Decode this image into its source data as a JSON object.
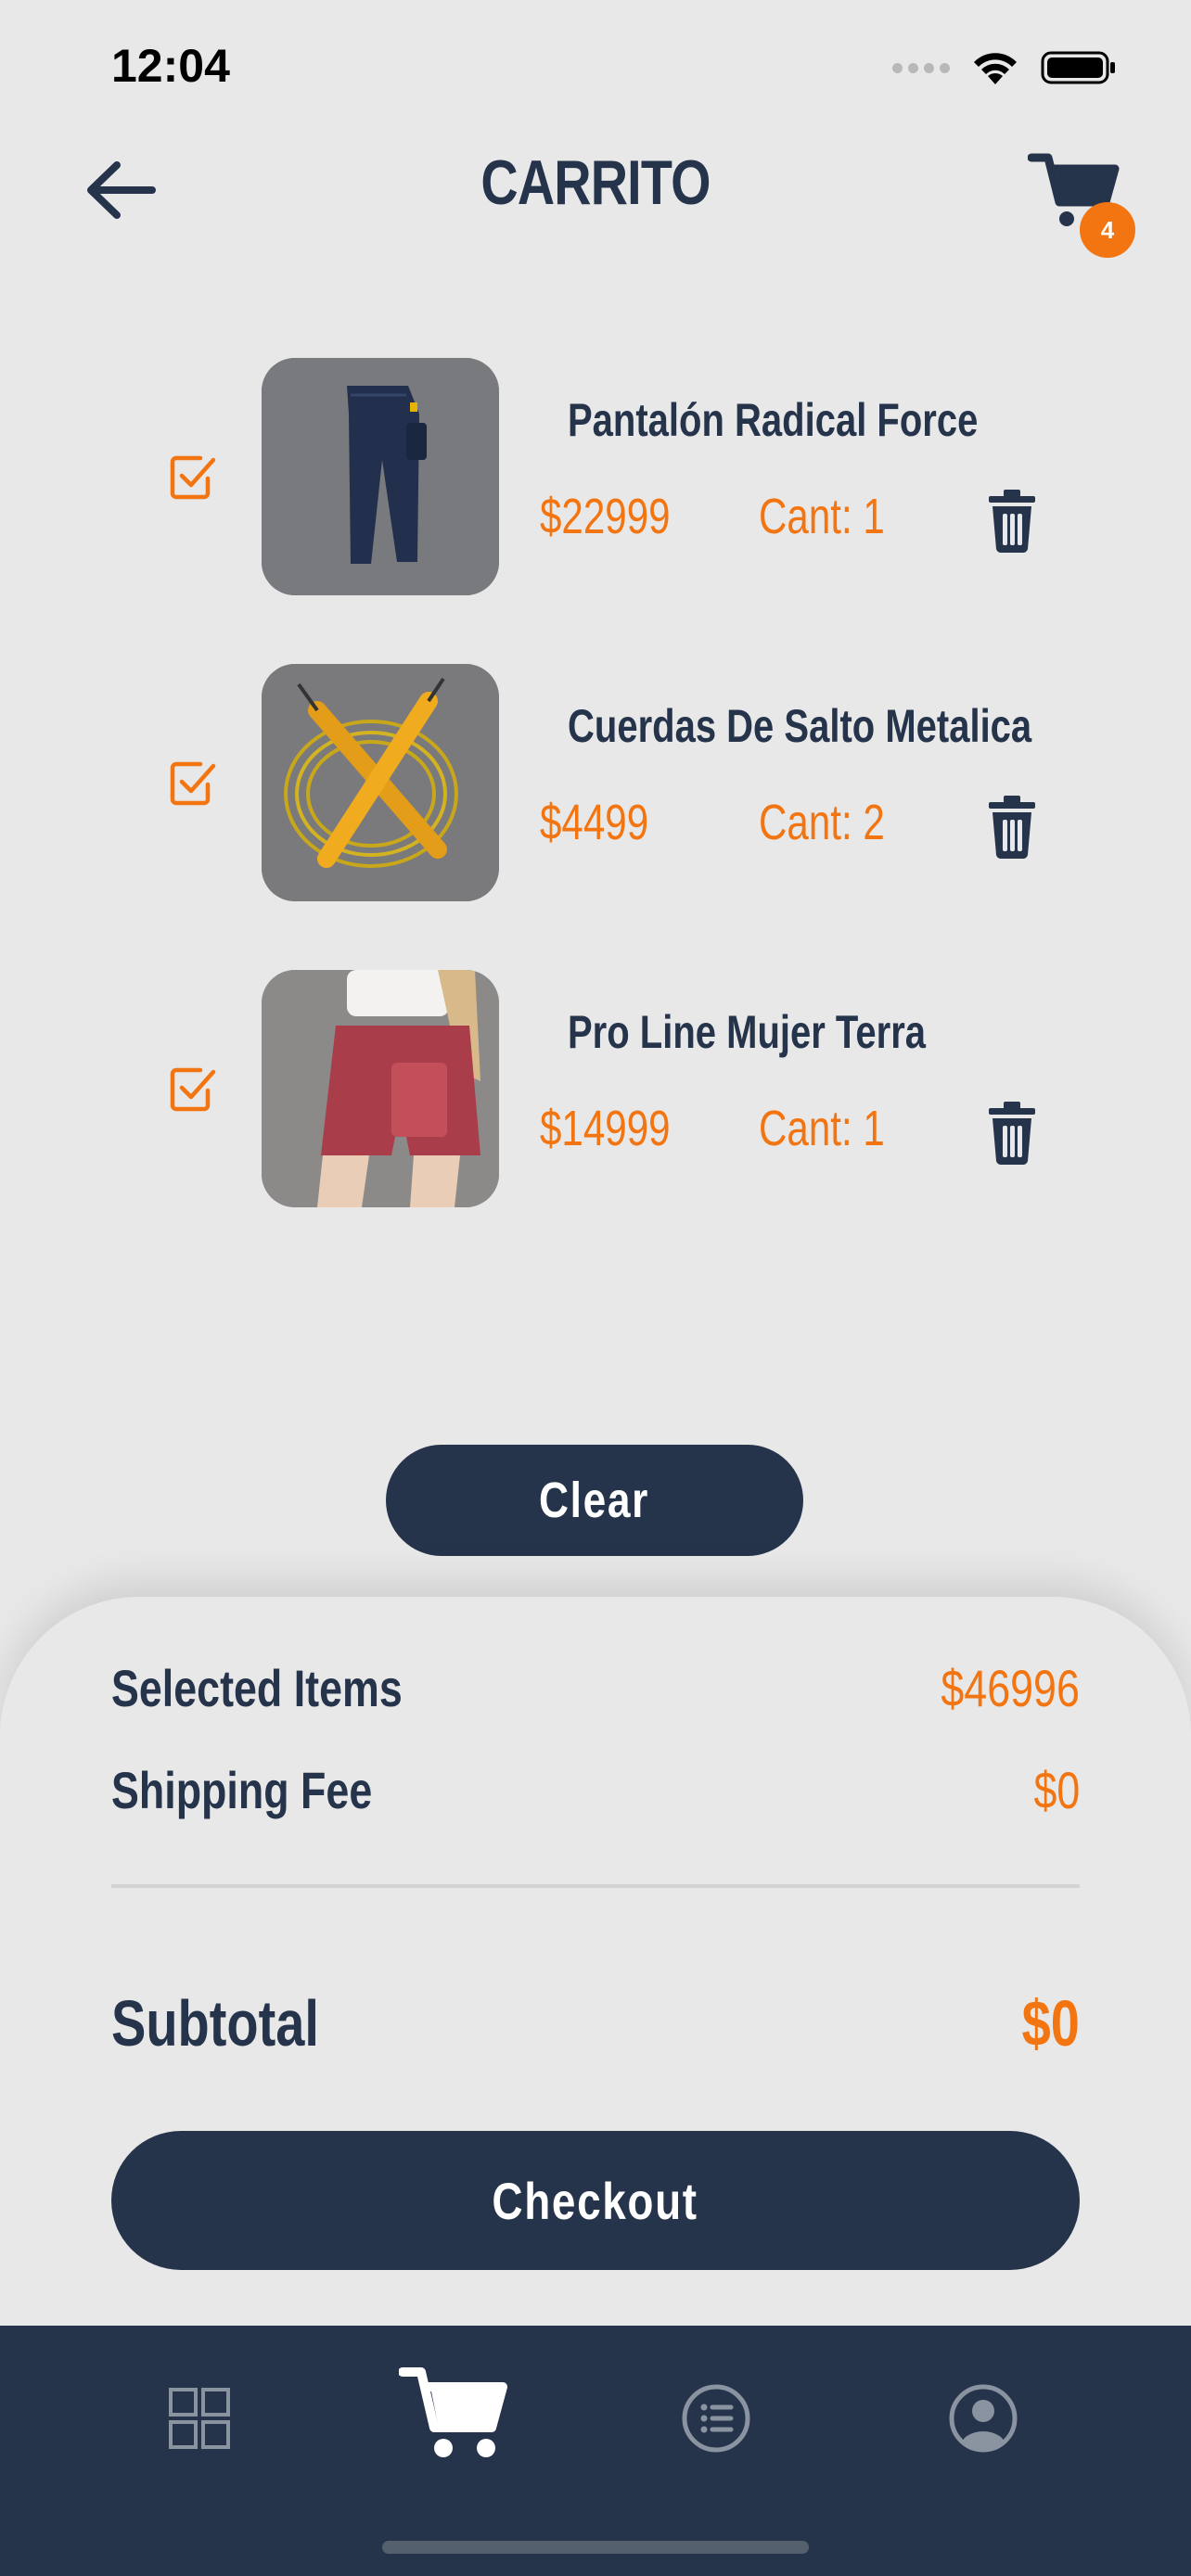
{
  "status_bar": {
    "time": "12:04"
  },
  "header": {
    "title": "CARRITO",
    "cart_badge": "4"
  },
  "items": [
    {
      "name": "Pantalón Radical Force",
      "price": "$22999",
      "quantity": "Cant: 1",
      "selected": true,
      "image": "navy cargo pants"
    },
    {
      "name": "Cuerdas De Salto Metalica",
      "price": "$4499",
      "quantity": "Cant: 2",
      "selected": true,
      "image": "yellow jump rope"
    },
    {
      "name": "Pro Line Mujer Terra",
      "price": "$14999",
      "quantity": "Cant: 1",
      "selected": true,
      "image": "red bike shorts"
    }
  ],
  "actions": {
    "clear_label": "Clear",
    "checkout_label": "Checkout"
  },
  "summary": {
    "selected_items_label": "Selected Items",
    "selected_items_value": "$46996",
    "shipping_fee_label": "Shipping Fee",
    "shipping_fee_value": "$0",
    "subtotal_label": "Subtotal",
    "subtotal_value": "$0"
  },
  "bottom_nav": [
    {
      "icon": "grid-icon",
      "active": false
    },
    {
      "icon": "cart-icon",
      "active": true
    },
    {
      "icon": "list-icon",
      "active": false
    },
    {
      "icon": "profile-icon",
      "active": false
    }
  ],
  "colors": {
    "primary": "#26344b",
    "accent": "#f27511",
    "background": "#e8e8e9"
  }
}
